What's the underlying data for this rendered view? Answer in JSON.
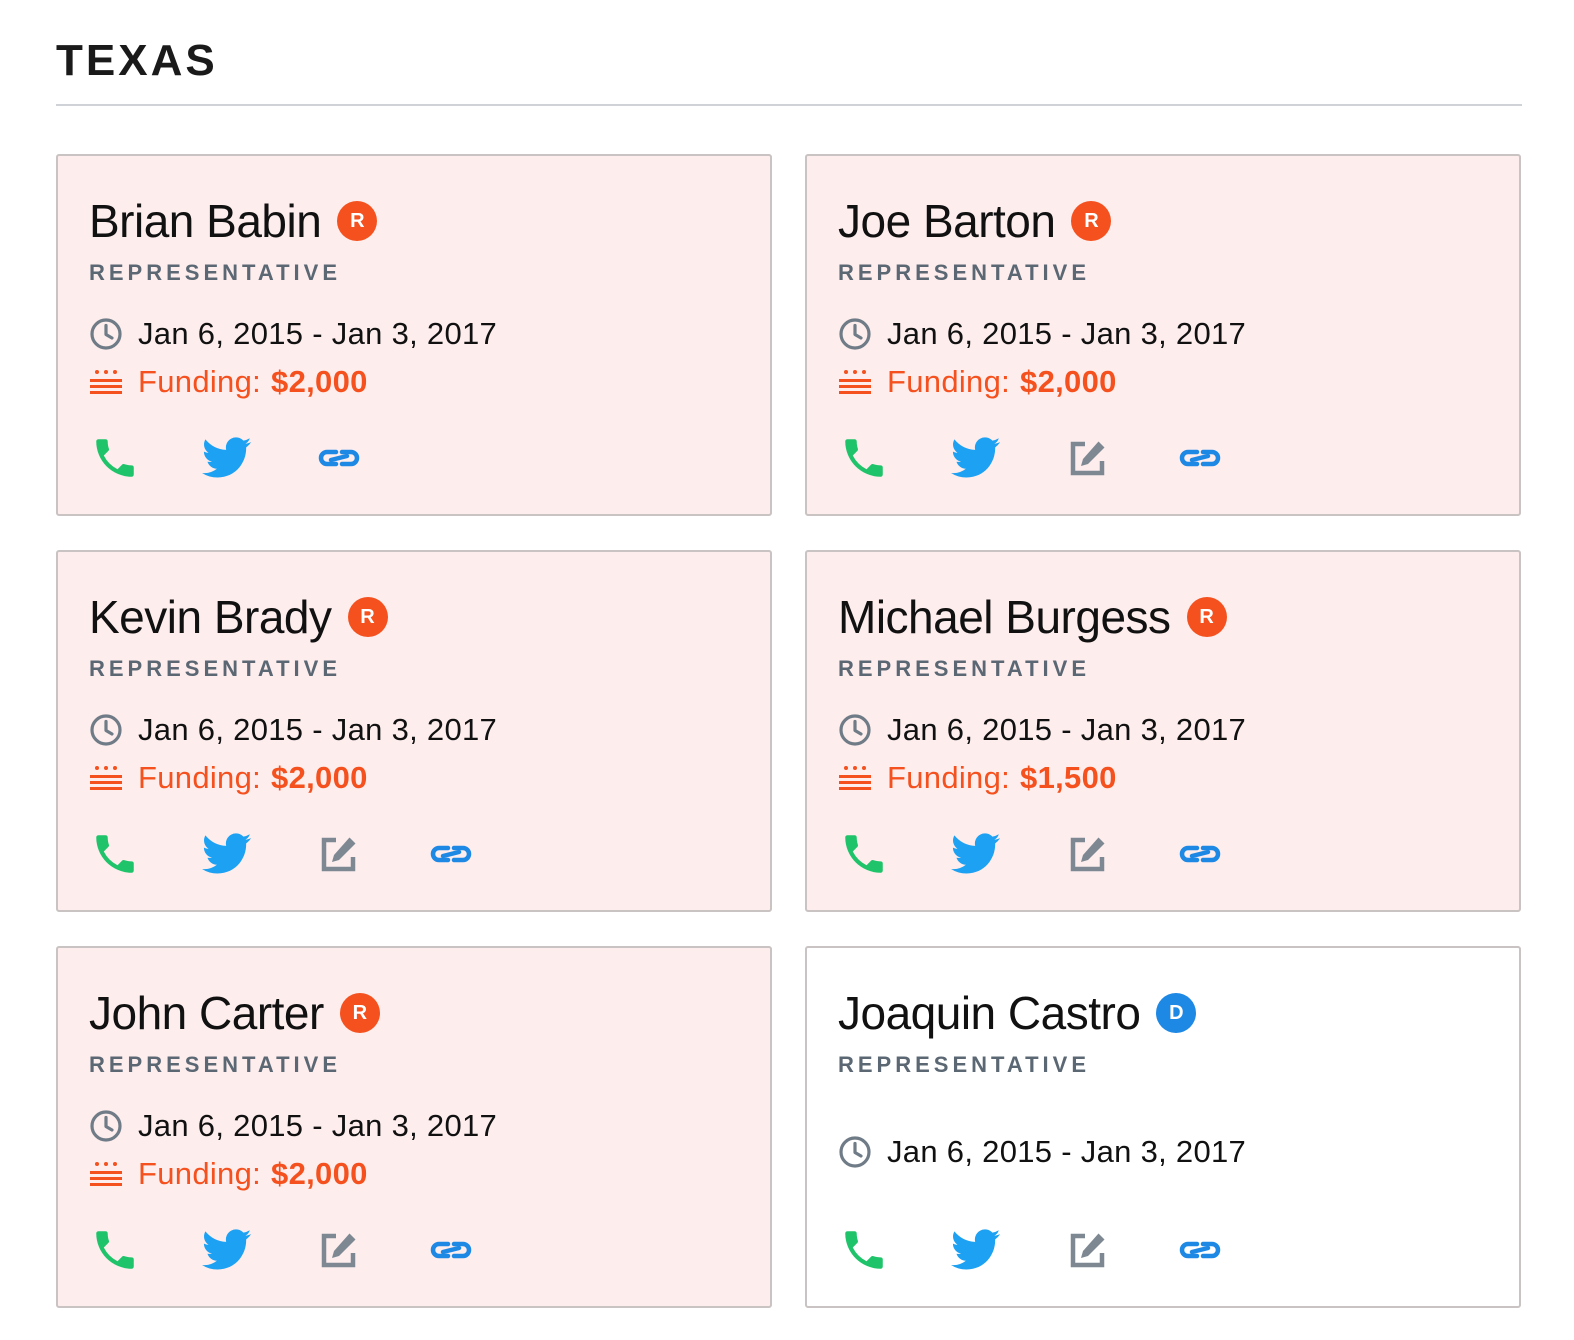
{
  "state": {
    "title": "TEXAS"
  },
  "colors": {
    "republican": "#f4511e",
    "democrat": "#1e88e5",
    "phone": "#1fc46a",
    "twitter": "#1da1f2",
    "contact_form": "#7d8892",
    "link": "#1e88e5",
    "funding": "#f4511e",
    "role": "#5b6874"
  },
  "legislators": [
    {
      "name": "Brian Babin",
      "party": "R",
      "role": "REPRESENTATIVE",
      "term": "Jan 6, 2015 - Jan 3, 2017",
      "funding_label": "Funding:",
      "funding_amount": "$2,000",
      "actions": [
        "phone-icon",
        "twitter-icon",
        "link-icon"
      ]
    },
    {
      "name": "Joe Barton",
      "party": "R",
      "role": "REPRESENTATIVE",
      "term": "Jan 6, 2015 - Jan 3, 2017",
      "funding_label": "Funding:",
      "funding_amount": "$2,000",
      "actions": [
        "phone-icon",
        "twitter-icon",
        "contact-form-icon",
        "link-icon"
      ]
    },
    {
      "name": "Kevin Brady",
      "party": "R",
      "role": "REPRESENTATIVE",
      "term": "Jan 6, 2015 - Jan 3, 2017",
      "funding_label": "Funding:",
      "funding_amount": "$2,000",
      "actions": [
        "phone-icon",
        "twitter-icon",
        "contact-form-icon",
        "link-icon"
      ]
    },
    {
      "name": "Michael Burgess",
      "party": "R",
      "role": "REPRESENTATIVE",
      "term": "Jan 6, 2015 - Jan 3, 2017",
      "funding_label": "Funding:",
      "funding_amount": "$1,500",
      "actions": [
        "phone-icon",
        "twitter-icon",
        "contact-form-icon",
        "link-icon"
      ]
    },
    {
      "name": "John Carter",
      "party": "R",
      "role": "REPRESENTATIVE",
      "term": "Jan 6, 2015 - Jan 3, 2017",
      "funding_label": "Funding:",
      "funding_amount": "$2,000",
      "actions": [
        "phone-icon",
        "twitter-icon",
        "contact-form-icon",
        "link-icon"
      ]
    },
    {
      "name": "Joaquin Castro",
      "party": "D",
      "role": "REPRESENTATIVE",
      "term": "Jan 6, 2015 - Jan 3, 2017",
      "funding_label": "",
      "funding_amount": "",
      "actions": [
        "phone-icon",
        "twitter-icon",
        "contact-form-icon",
        "link-icon"
      ]
    }
  ]
}
